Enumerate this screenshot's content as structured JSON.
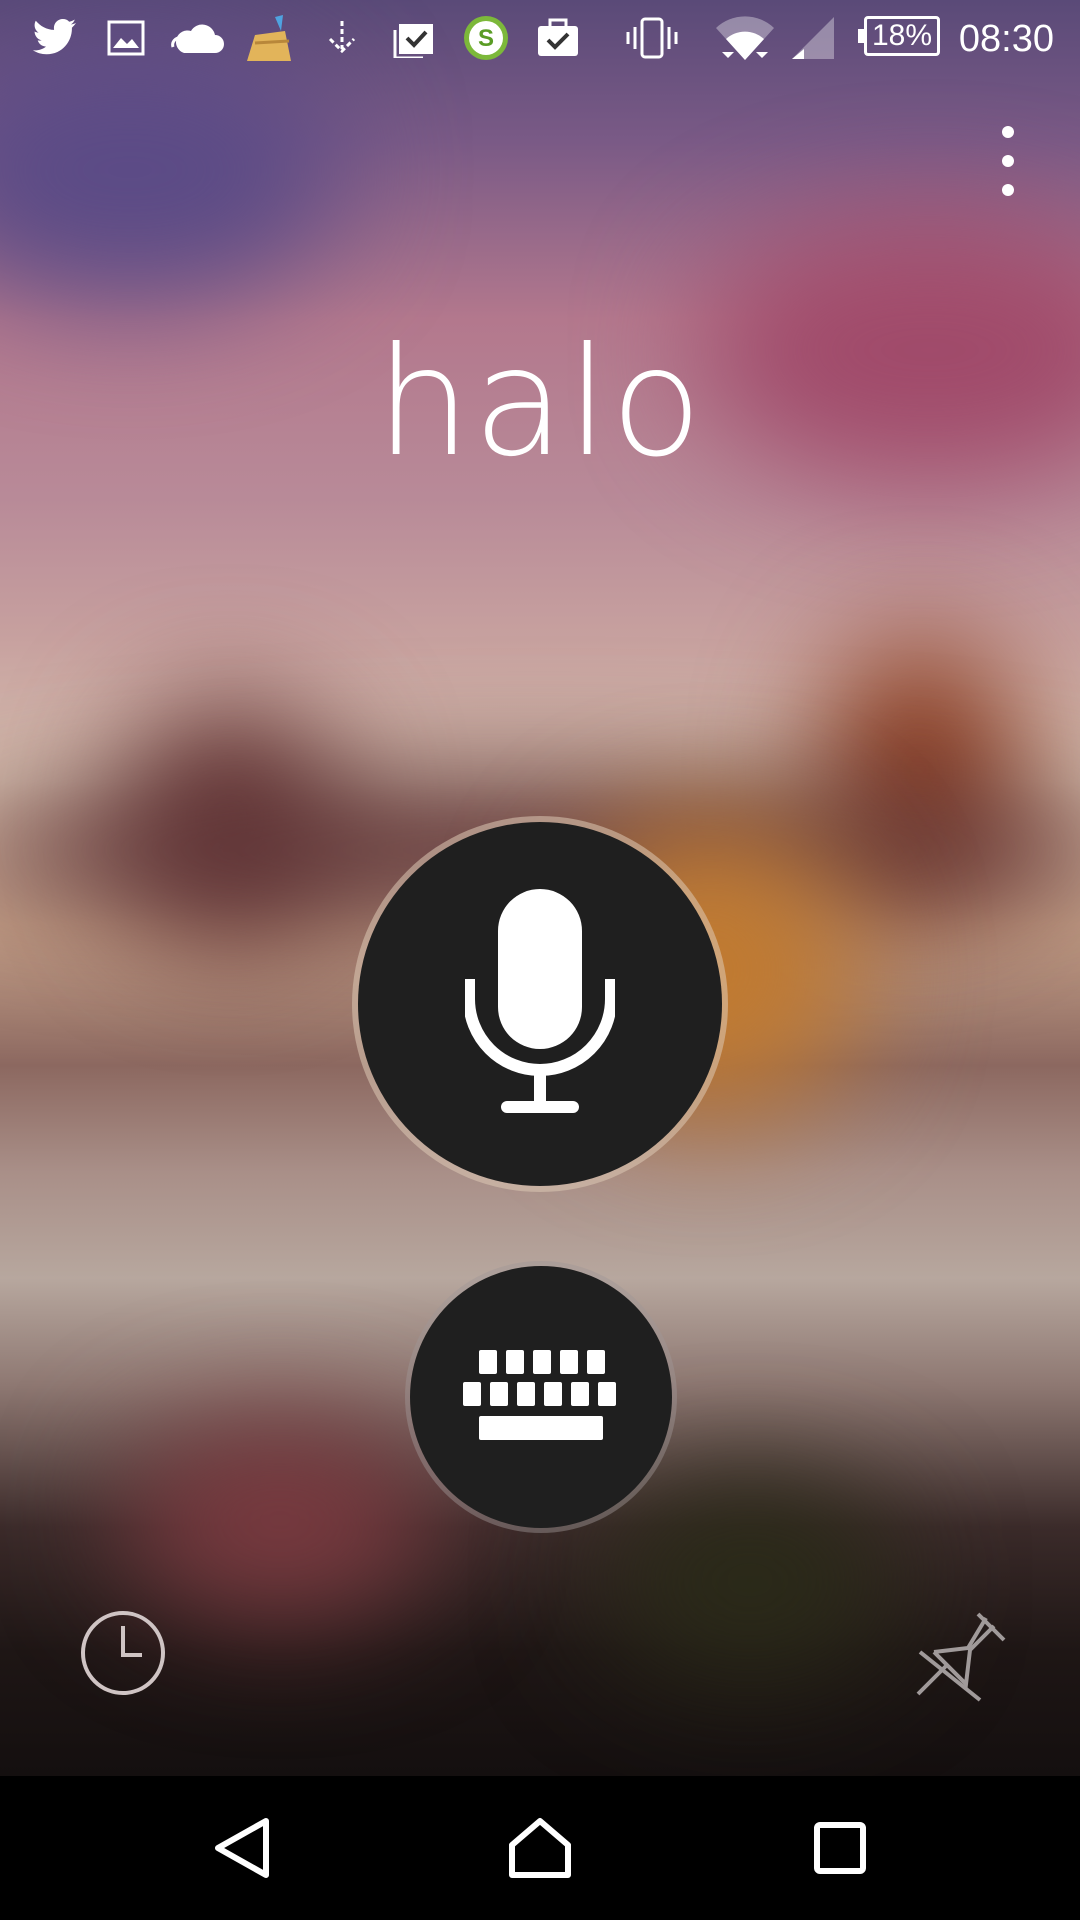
{
  "status_bar": {
    "time": "08:30",
    "battery": "18%",
    "notification_icons": [
      "twitter-icon",
      "image-icon",
      "cloud-icon",
      "cleaner-broom-icon",
      "download-icon",
      "clipboard-check-icon",
      "app-s-icon",
      "briefcase-check-icon"
    ],
    "system_icons": [
      "vibrate-icon",
      "wifi-icon",
      "signal-icon",
      "battery-icon"
    ]
  },
  "query_text": "halo",
  "buttons": {
    "mic_icon": "microphone-icon",
    "keyboard_icon": "keyboard-icon",
    "history_icon": "clock-icon",
    "pin_icon": "pin-off-icon",
    "menu_icon": "more-vertical-icon"
  },
  "navbar": {
    "back": "back-icon",
    "home": "home-icon",
    "recents": "recents-icon"
  },
  "colors": {
    "button_fill": "#1f1f1f",
    "text": "#ffffff",
    "navbar": "#000000"
  }
}
